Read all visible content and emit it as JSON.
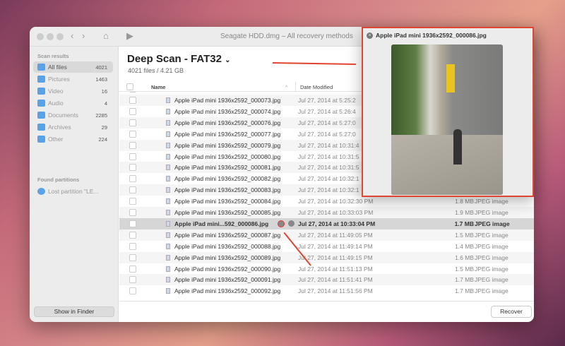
{
  "window": {
    "title": "Seagate HDD.dmg – All recovery methods"
  },
  "sidebar": {
    "scan_results_label": "Scan results",
    "items": [
      {
        "label": "All files",
        "count": "4021",
        "icon": "folder-icon"
      },
      {
        "label": "Pictures",
        "count": "1463",
        "icon": "picture-icon"
      },
      {
        "label": "Video",
        "count": "16",
        "icon": "video-icon"
      },
      {
        "label": "Audio",
        "count": "4",
        "icon": "music-icon"
      },
      {
        "label": "Documents",
        "count": "2285",
        "icon": "document-icon"
      },
      {
        "label": "Archives",
        "count": "29",
        "icon": "archive-icon"
      },
      {
        "label": "Other",
        "count": "224",
        "icon": "folder-icon"
      }
    ],
    "found_partitions_label": "Found partitions",
    "partition": "Lost partition \"LE...",
    "show_in_finder": "Show in Finder"
  },
  "main": {
    "title": "Deep Scan - FAT32",
    "title_chevron": "⌄",
    "subtitle": "4021 files / 4.21 GB",
    "columns": {
      "name": "Name",
      "date": "Date Modified",
      "sort_arrow": "^"
    },
    "rows": [
      {
        "name": "Apple iPad mini 1936x2592_000073.jpg",
        "date": "Jul 27, 2014 at 5:25:2",
        "size": "",
        "kind": ""
      },
      {
        "name": "Apple iPad mini 1936x2592_000074.jpg",
        "date": "Jul 27, 2014 at 5:26:4",
        "size": "",
        "kind": ""
      },
      {
        "name": "Apple iPad mini 1936x2592_000076.jpg",
        "date": "Jul 27, 2014 at 5:27:0",
        "size": "",
        "kind": ""
      },
      {
        "name": "Apple iPad mini 1936x2592_000077.jpg",
        "date": "Jul 27, 2014 at 5:27:0",
        "size": "",
        "kind": ""
      },
      {
        "name": "Apple iPad mini 1936x2592_000079.jpg",
        "date": "Jul 27, 2014 at 10:31:4",
        "size": "",
        "kind": ""
      },
      {
        "name": "Apple iPad mini 1936x2592_000080.jpg",
        "date": "Jul 27, 2014 at 10:31:5",
        "size": "",
        "kind": ""
      },
      {
        "name": "Apple iPad mini 1936x2592_000081.jpg",
        "date": "Jul 27, 2014 at 10:31:5",
        "size": "",
        "kind": ""
      },
      {
        "name": "Apple iPad mini 1936x2592_000082.jpg",
        "date": "Jul 27, 2014 at 10:32:1",
        "size": "",
        "kind": ""
      },
      {
        "name": "Apple iPad mini 1936x2592_000083.jpg",
        "date": "Jul 27, 2014 at 10:32:1",
        "size": "",
        "kind": ""
      },
      {
        "name": "Apple iPad mini 1936x2592_000084.jpg",
        "date": "Jul 27, 2014 at 10:32:30 PM",
        "size": "1.8 MB",
        "kind": "JPEG image"
      },
      {
        "name": "Apple iPad mini 1936x2592_000085.jpg",
        "date": "Jul 27, 2014 at 10:33:03 PM",
        "size": "1.9 MB",
        "kind": "JPEG image"
      },
      {
        "name": "Apple iPad mini...592_000086.jpg",
        "date": "Jul 27, 2014 at 10:33:04 PM",
        "size": "1.7 MB",
        "kind": "JPEG image",
        "selected": true
      },
      {
        "name": "Apple iPad mini 1936x2592_000087.jpg",
        "date": "Jul 27, 2014 at 11:49:05 PM",
        "size": "1.5 MB",
        "kind": "JPEG image"
      },
      {
        "name": "Apple iPad mini 1936x2592_000088.jpg",
        "date": "Jul 27, 2014 at 11:49:14 PM",
        "size": "1.4 MB",
        "kind": "JPEG image"
      },
      {
        "name": "Apple iPad mini 1936x2592_000089.jpg",
        "date": "Jul 27, 2014 at 11:49:15 PM",
        "size": "1.6 MB",
        "kind": "JPEG image"
      },
      {
        "name": "Apple iPad mini 1936x2592_000090.jpg",
        "date": "Jul 27, 2014 at 11:51:13 PM",
        "size": "1.5 MB",
        "kind": "JPEG image"
      },
      {
        "name": "Apple iPad mini 1936x2592_000091.jpg",
        "date": "Jul 27, 2014 at 11:51:41 PM",
        "size": "1.7 MB",
        "kind": "JPEG image"
      },
      {
        "name": "Apple iPad mini 1936x2592_000092.jpg",
        "date": "Jul 27, 2014 at 11:51:56 PM",
        "size": "1.7 MB",
        "kind": "JPEG image"
      }
    ],
    "recover": "Recover"
  },
  "preview": {
    "title": "Apple iPad mini 1936x2592_000086.jpg",
    "close": "×"
  },
  "colors": {
    "accent": "#e0452f",
    "selection": "#d6d6d6",
    "icon": "#5aa2e8"
  }
}
